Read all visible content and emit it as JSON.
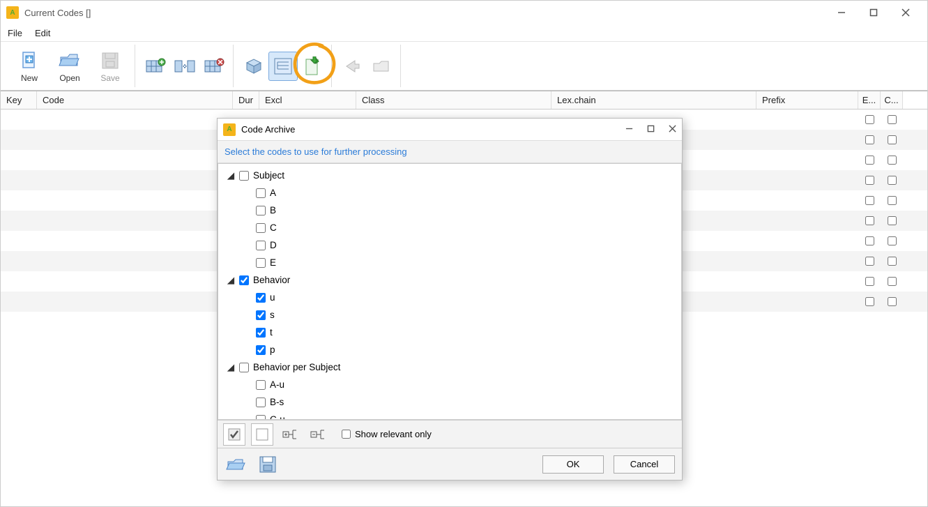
{
  "window": {
    "title": "Current Codes []"
  },
  "menu": {
    "file": "File",
    "edit": "Edit"
  },
  "toolbar": {
    "new": "New",
    "open": "Open",
    "save": "Save"
  },
  "columns": {
    "key": "Key",
    "code": "Code",
    "dur": "Dur",
    "excl": "Excl",
    "class": "Class",
    "lex": "Lex.chain",
    "prefix": "Prefix",
    "e": "E...",
    "c": "C..."
  },
  "dialog": {
    "title": "Code Archive",
    "subtitle": "Select the codes to use for further processing",
    "tree": {
      "subject": {
        "label": "Subject",
        "checked": false,
        "items": [
          {
            "label": "A",
            "checked": false
          },
          {
            "label": "B",
            "checked": false
          },
          {
            "label": "C",
            "checked": false
          },
          {
            "label": "D",
            "checked": false
          },
          {
            "label": "E",
            "checked": false
          }
        ]
      },
      "behavior": {
        "label": "Behavior",
        "checked": true,
        "items": [
          {
            "label": "u",
            "checked": true
          },
          {
            "label": "s",
            "checked": true
          },
          {
            "label": "t",
            "checked": true
          },
          {
            "label": "p",
            "checked": true
          }
        ]
      },
      "bps": {
        "label": "Behavior per Subject",
        "checked": false,
        "items": [
          {
            "label": "A-u",
            "checked": false
          },
          {
            "label": "B-s",
            "checked": false
          },
          {
            "label": "C-u",
            "checked": false
          }
        ]
      }
    },
    "show_relevant": "Show relevant only",
    "ok": "OK",
    "cancel": "Cancel"
  }
}
